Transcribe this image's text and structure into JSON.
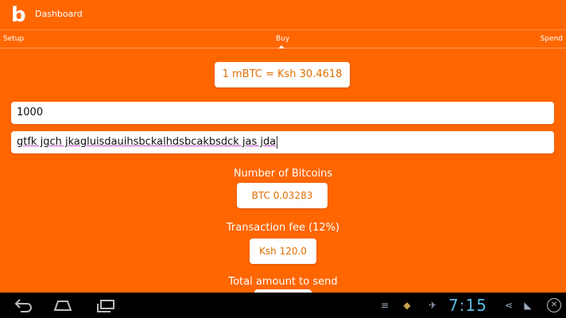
{
  "app": {
    "title": "Dashboard",
    "logo_letter": "b"
  },
  "tabs": [
    "Setup",
    "Buy",
    "Spend"
  ],
  "buy": {
    "rate": "1 mBTC = Ksh 30.4618",
    "amount_value": "1000",
    "address_value": "gtfk jgch jkagluisdauihsbckalhdsbcakbsdck jas jda",
    "bitcoins_label": "Number of Bitcoins",
    "bitcoins_value": "BTC 0.03283",
    "fee_label": "Transaction fee (12%)",
    "fee_value": "Ksh 120.0",
    "total_label": "Total amount to send"
  },
  "status": {
    "time": "7:15"
  },
  "icons": {
    "back": "back-arrow-icon",
    "home": "home-icon",
    "recent": "recent-apps-icon",
    "menu": "menu-icon",
    "android": "android-icon",
    "twitter": "twitter-icon",
    "share": "share-icon",
    "wifi": "wifi-icon",
    "close": "close-icon"
  },
  "colors": {
    "background": "#ff6600",
    "accent_text": "#e07000",
    "clock": "#5fb8e6"
  }
}
